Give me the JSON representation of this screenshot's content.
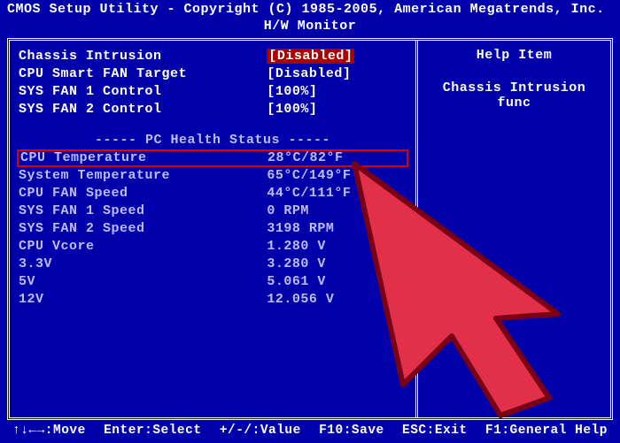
{
  "title": "CMOS Setup Utility - Copyright (C) 1985-2005, American Megatrends, Inc.",
  "subtitle": "H/W Monitor",
  "settings": [
    {
      "label": "Chassis Intrusion",
      "value": "[Disabled]",
      "selected": true
    },
    {
      "label": "CPU Smart FAN Target",
      "value": "[Disabled]",
      "selected": false
    },
    {
      "label": "SYS FAN 1 Control",
      "value": "[100%]",
      "selected": false
    },
    {
      "label": "SYS FAN 2 Control",
      "value": "[100%]",
      "selected": false
    }
  ],
  "section_title": "----- PC Health Status -----",
  "health": [
    {
      "label": "CPU Temperature",
      "value": "28°C/82°F",
      "highlight": true
    },
    {
      "label": "System Temperature",
      "value": "65°C/149°F"
    },
    {
      "label": "CPU FAN Speed",
      "value": "44°C/111°F"
    },
    {
      "label": "SYS FAN 1 Speed",
      "value": "0 RPM"
    },
    {
      "label": "SYS FAN 2 Speed",
      "value": "3198 RPM"
    },
    {
      "label": "CPU Vcore",
      "value": "1.280 V"
    },
    {
      "label": "3.3V",
      "value": "3.280 V"
    },
    {
      "label": "5V",
      "value": "5.061 V"
    },
    {
      "label": "12V",
      "value": "12.056 V"
    }
  ],
  "help": {
    "title": "Help Item",
    "text": "Chassis Intrusion func"
  },
  "footer": {
    "move": "↑↓←→:Move",
    "enter": "Enter:Select",
    "change": "+/-/:Value",
    "save": "F10:Save",
    "exit": "ESC:Exit",
    "general": "F1:General Help"
  }
}
